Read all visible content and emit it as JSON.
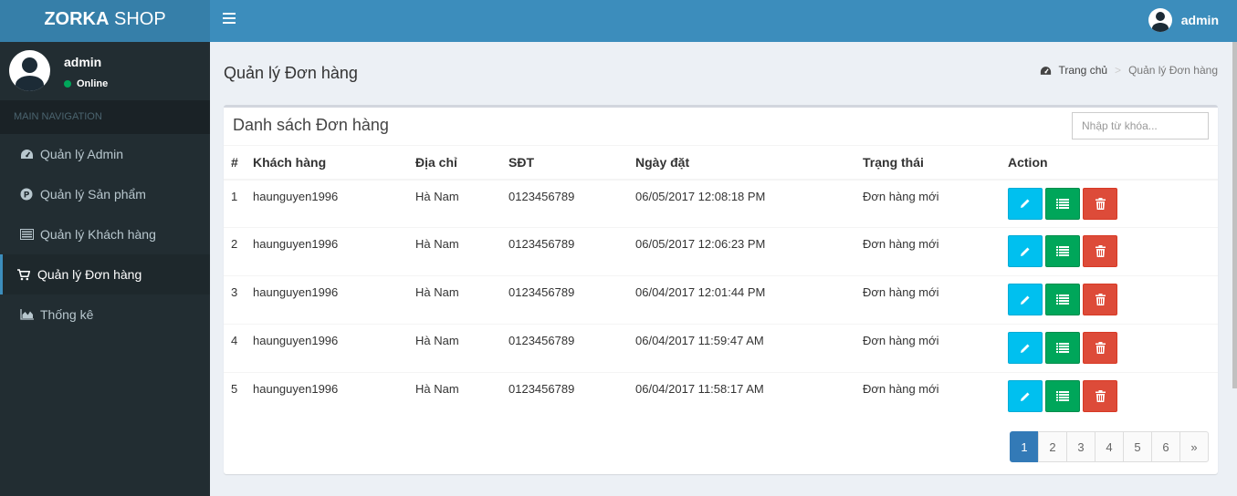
{
  "brand": {
    "bold": "ZORKA",
    "light": " SHOP"
  },
  "topbar": {
    "user_name": "admin"
  },
  "sidebar": {
    "user_name": "admin",
    "status": "Online",
    "nav_header": "MAIN NAVIGATION",
    "items": [
      {
        "label": "Quản lý Admin",
        "icon": "dashboard-icon"
      },
      {
        "label": "Quản lý Sản phẩm",
        "icon": "product-p-icon"
      },
      {
        "label": "Quản lý Khách hàng",
        "icon": "list-icon"
      },
      {
        "label": "Quản lý Đơn hàng",
        "icon": "cart-icon",
        "active": true
      },
      {
        "label": "Thống kê",
        "icon": "area-chart-icon"
      }
    ]
  },
  "content": {
    "title": "Quản lý Đơn hàng",
    "breadcrumb": {
      "home": "Trang chủ",
      "current": "Quản lý Đơn hàng"
    }
  },
  "box": {
    "title": "Danh sách Đơn hàng",
    "search_placeholder": "Nhập từ khóa...",
    "columns": [
      "#",
      "Khách hàng",
      "Địa chỉ",
      "SĐT",
      "Ngày đặt",
      "Trạng thái",
      "Action"
    ],
    "rows": [
      {
        "id": "1",
        "customer": "haunguyen1996",
        "address": "Hà Nam",
        "phone": "0123456789",
        "date": "06/05/2017 12:08:18 PM",
        "status": "Đơn hàng mới"
      },
      {
        "id": "2",
        "customer": "haunguyen1996",
        "address": "Hà Nam",
        "phone": "0123456789",
        "date": "06/05/2017 12:06:23 PM",
        "status": "Đơn hàng mới"
      },
      {
        "id": "3",
        "customer": "haunguyen1996",
        "address": "Hà Nam",
        "phone": "0123456789",
        "date": "06/04/2017 12:01:44 PM",
        "status": "Đơn hàng mới"
      },
      {
        "id": "4",
        "customer": "haunguyen1996",
        "address": "Hà Nam",
        "phone": "0123456789",
        "date": "06/04/2017 11:59:47 AM",
        "status": "Đơn hàng mới"
      },
      {
        "id": "5",
        "customer": "haunguyen1996",
        "address": "Hà Nam",
        "phone": "0123456789",
        "date": "06/04/2017 11:58:17 AM",
        "status": "Đơn hàng mới"
      }
    ],
    "pagination": [
      "1",
      "2",
      "3",
      "4",
      "5",
      "6",
      "»"
    ],
    "active_page": "1"
  },
  "colors": {
    "header": "#3c8dbc",
    "logo": "#367fa9",
    "sidebar": "#222d32",
    "edit": "#00c0ef",
    "list": "#00a65a",
    "delete": "#dd4b39"
  }
}
